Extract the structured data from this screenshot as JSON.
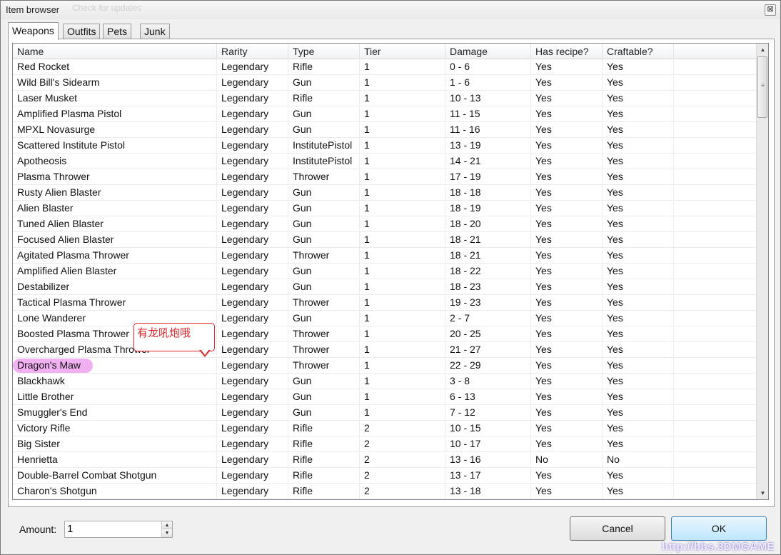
{
  "window": {
    "title": "Item browser",
    "ghost_text": "Check for updates",
    "close_glyph": "⊠"
  },
  "tabs": [
    {
      "label": "Weapons",
      "active": true
    },
    {
      "label": "Outfits",
      "active": false
    },
    {
      "label": "Pets",
      "active": false
    },
    {
      "label": "Junk",
      "active": false
    }
  ],
  "table": {
    "columns": [
      "Name",
      "Rarity",
      "Type",
      "Tier",
      "Damage",
      "Has recipe?",
      "Craftable?",
      ""
    ],
    "rows": [
      [
        "Red Rocket",
        "Legendary",
        "Rifle",
        "1",
        "0 - 6",
        "Yes",
        "Yes"
      ],
      [
        "Wild Bill's Sidearm",
        "Legendary",
        "Gun",
        "1",
        "1 - 6",
        "Yes",
        "Yes"
      ],
      [
        "Laser Musket",
        "Legendary",
        "Rifle",
        "1",
        "10 - 13",
        "Yes",
        "Yes"
      ],
      [
        "Amplified Plasma Pistol",
        "Legendary",
        "Gun",
        "1",
        "11 - 15",
        "Yes",
        "Yes"
      ],
      [
        "MPXL Novasurge",
        "Legendary",
        "Gun",
        "1",
        "11 - 16",
        "Yes",
        "Yes"
      ],
      [
        "Scattered Institute Pistol",
        "Legendary",
        "InstitutePistol",
        "1",
        "13 - 19",
        "Yes",
        "Yes"
      ],
      [
        "Apotheosis",
        "Legendary",
        "InstitutePistol",
        "1",
        "14 - 21",
        "Yes",
        "Yes"
      ],
      [
        "Plasma Thrower",
        "Legendary",
        "Thrower",
        "1",
        "17 - 19",
        "Yes",
        "Yes"
      ],
      [
        "Rusty Alien Blaster",
        "Legendary",
        "Gun",
        "1",
        "18 - 18",
        "Yes",
        "Yes"
      ],
      [
        "Alien Blaster",
        "Legendary",
        "Gun",
        "1",
        "18 - 19",
        "Yes",
        "Yes"
      ],
      [
        "Tuned Alien Blaster",
        "Legendary",
        "Gun",
        "1",
        "18 - 20",
        "Yes",
        "Yes"
      ],
      [
        "Focused Alien Blaster",
        "Legendary",
        "Gun",
        "1",
        "18 - 21",
        "Yes",
        "Yes"
      ],
      [
        "Agitated Plasma Thrower",
        "Legendary",
        "Thrower",
        "1",
        "18 - 21",
        "Yes",
        "Yes"
      ],
      [
        "Amplified Alien Blaster",
        "Legendary",
        "Gun",
        "1",
        "18 - 22",
        "Yes",
        "Yes"
      ],
      [
        "Destabilizer",
        "Legendary",
        "Gun",
        "1",
        "18 - 23",
        "Yes",
        "Yes"
      ],
      [
        "Tactical Plasma Thrower",
        "Legendary",
        "Thrower",
        "1",
        "19 - 23",
        "Yes",
        "Yes"
      ],
      [
        "Lone Wanderer",
        "Legendary",
        "Gun",
        "1",
        "2 - 7",
        "Yes",
        "Yes"
      ],
      [
        "Boosted Plasma Thrower",
        "Legendary",
        "Thrower",
        "1",
        "20 - 25",
        "Yes",
        "Yes"
      ],
      [
        "Overcharged Plasma Thrower",
        "Legendary",
        "Thrower",
        "1",
        "21 - 27",
        "Yes",
        "Yes"
      ],
      [
        "Dragon's Maw",
        "Legendary",
        "Thrower",
        "1",
        "22 - 29",
        "Yes",
        "Yes"
      ],
      [
        "Blackhawk",
        "Legendary",
        "Gun",
        "1",
        "3 - 8",
        "Yes",
        "Yes"
      ],
      [
        "Little Brother",
        "Legendary",
        "Gun",
        "1",
        "6 - 13",
        "Yes",
        "Yes"
      ],
      [
        "Smuggler's End",
        "Legendary",
        "Gun",
        "1",
        "7 - 12",
        "Yes",
        "Yes"
      ],
      [
        "Victory Rifle",
        "Legendary",
        "Rifle",
        "2",
        "10 - 15",
        "Yes",
        "Yes"
      ],
      [
        "Big Sister",
        "Legendary",
        "Rifle",
        "2",
        "10 - 17",
        "Yes",
        "Yes"
      ],
      [
        "Henrietta",
        "Legendary",
        "Rifle",
        "2",
        "13 - 16",
        "No",
        "No"
      ],
      [
        "Double-Barrel Combat Shotgun",
        "Legendary",
        "Rifle",
        "2",
        "13 - 17",
        "Yes",
        "Yes"
      ],
      [
        "Charon's Shotgun",
        "Legendary",
        "Rifle",
        "2",
        "13 - 18",
        "Yes",
        "Yes"
      ]
    ],
    "highlighted_row": 19
  },
  "annotation": {
    "callout_text": "有龙吼炮哦"
  },
  "scrollbar": {
    "up_glyph": "▲",
    "down_glyph": "▼",
    "grip_glyph": "≡"
  },
  "footer": {
    "amount_label": "Amount:",
    "amount_value": "1",
    "spin_up_glyph": "▲",
    "spin_down_glyph": "▼",
    "cancel_label": "Cancel",
    "ok_label": "OK"
  },
  "watermark": "http://bbs.3DMGAME"
}
